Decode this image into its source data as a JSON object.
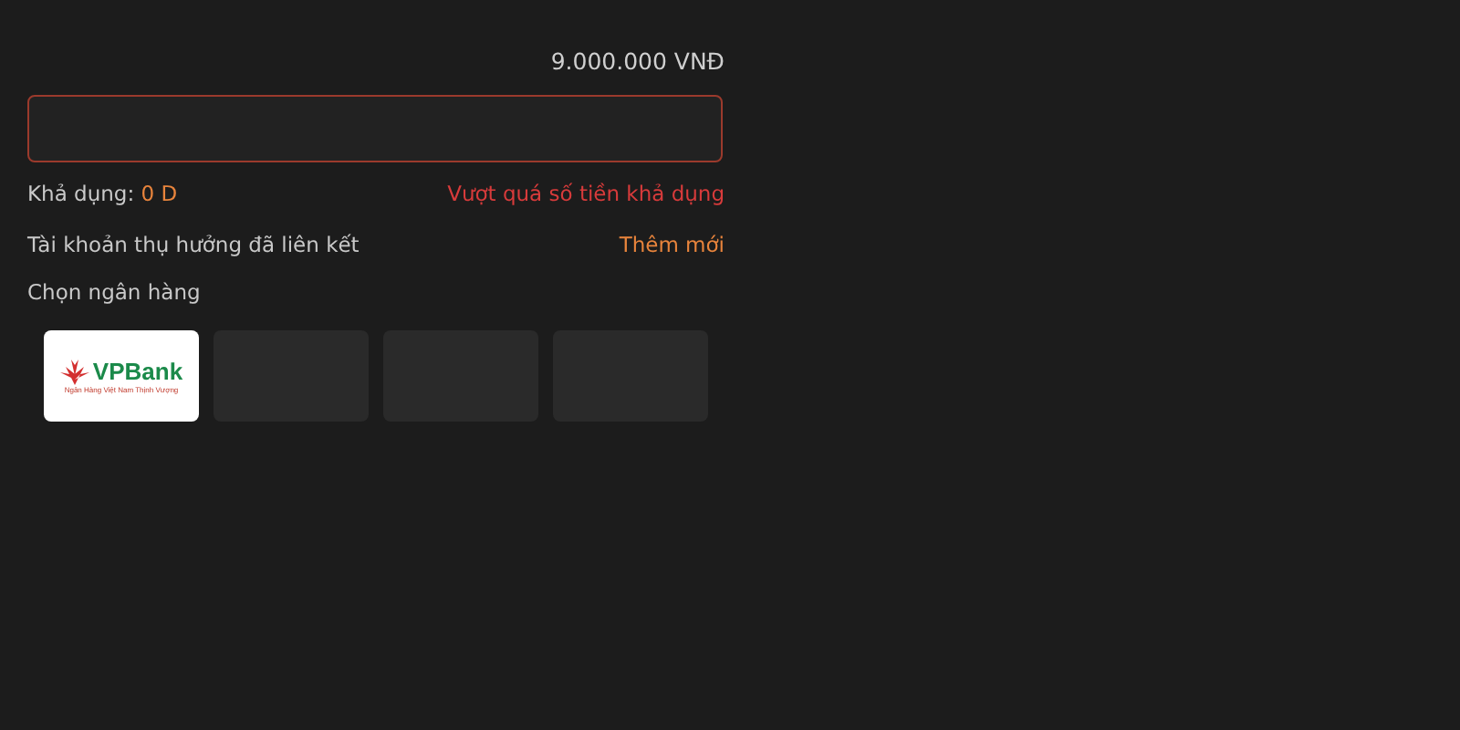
{
  "amount": "9.000.000 VNĐ",
  "amount_field": {
    "error": true
  },
  "available": {
    "label": "Khả dụng:",
    "value": "0 D"
  },
  "error_message": "Vượt quá số tiền khả dụng",
  "linked_accounts": {
    "label": "Tài khoản thụ hưởng đã liên kết",
    "action": "Thêm mới"
  },
  "bank_section": {
    "label": "Chọn ngân hàng"
  },
  "banks": [
    {
      "kind": "logo",
      "name": "VPBank",
      "tagline": "Ngân Hàng Việt Nam Thịnh Vượng"
    },
    {
      "kind": "empty"
    },
    {
      "kind": "empty"
    },
    {
      "kind": "empty"
    }
  ]
}
